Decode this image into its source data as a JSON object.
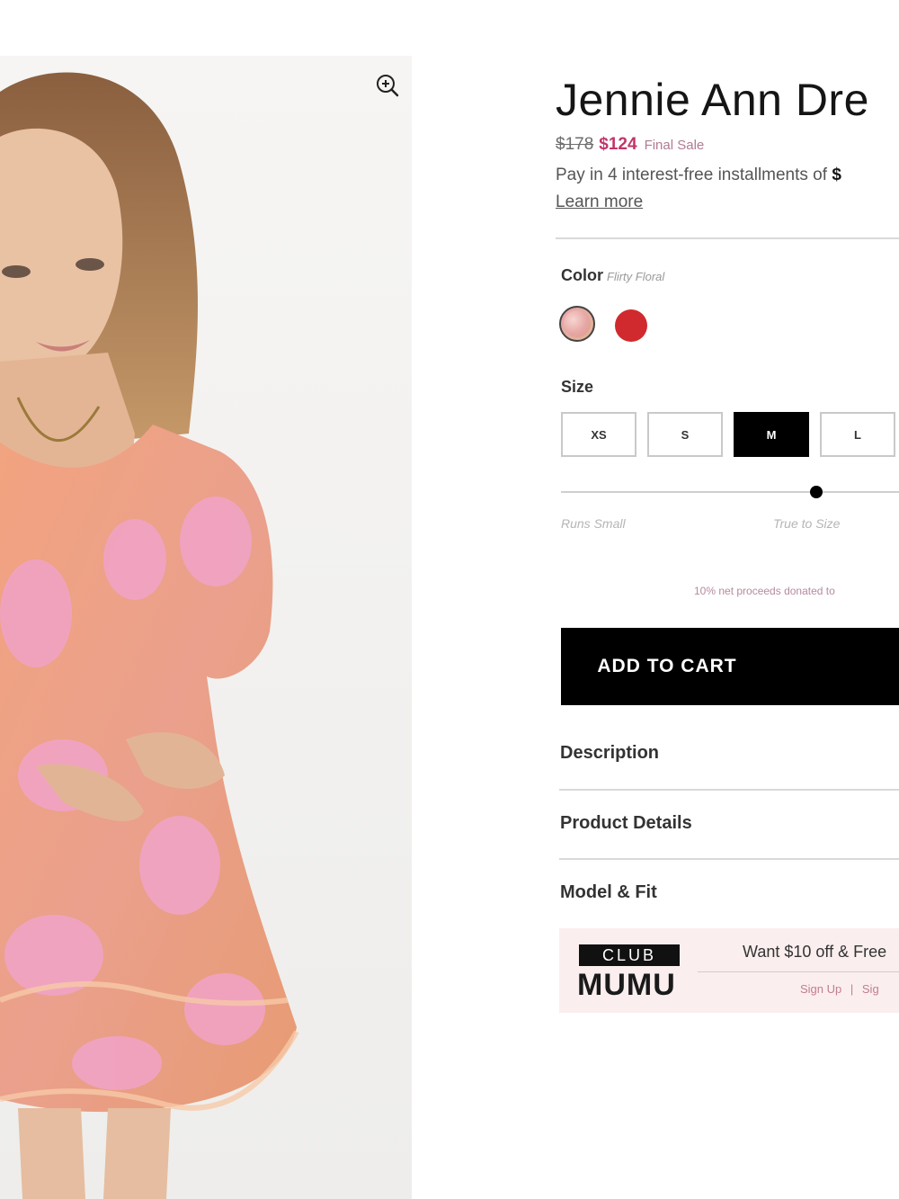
{
  "product": {
    "title": "Jennie Ann Dre",
    "original_price": "$178",
    "sale_price": "$124",
    "sale_note": "Final Sale",
    "installments_text": "Pay in 4 interest-free installments of",
    "installments_amount": "$",
    "learn_more": "Learn more"
  },
  "color": {
    "label": "Color",
    "selected_name": "Flirty Floral",
    "swatches": [
      {
        "name": "Flirty Floral",
        "hex": "#e8a7a6",
        "selected": true
      },
      {
        "name": "red",
        "hex": "#d02a2e",
        "selected": false
      }
    ]
  },
  "size": {
    "label": "Size",
    "options": [
      "XS",
      "S",
      "M",
      "L"
    ],
    "selected": "M"
  },
  "fit": {
    "left_label": "Runs Small",
    "mid_label": "True to Size"
  },
  "donation_text": "10% net proceeds donated to",
  "add_to_cart": "ADD TO CART",
  "accordions": [
    "Description",
    "Product Details",
    "Model & Fit"
  ],
  "club": {
    "badge": "CLUB",
    "name": "MUMU",
    "promo": "Want $10 off & Free",
    "link_signup": "Sign Up",
    "separator": "|",
    "link_signin": "Sig"
  },
  "icons": {
    "zoom": "zoom-in-icon"
  },
  "colors": {
    "sale": "#c2346b",
    "button": "#000000",
    "club_bg": "#fbeeee"
  }
}
